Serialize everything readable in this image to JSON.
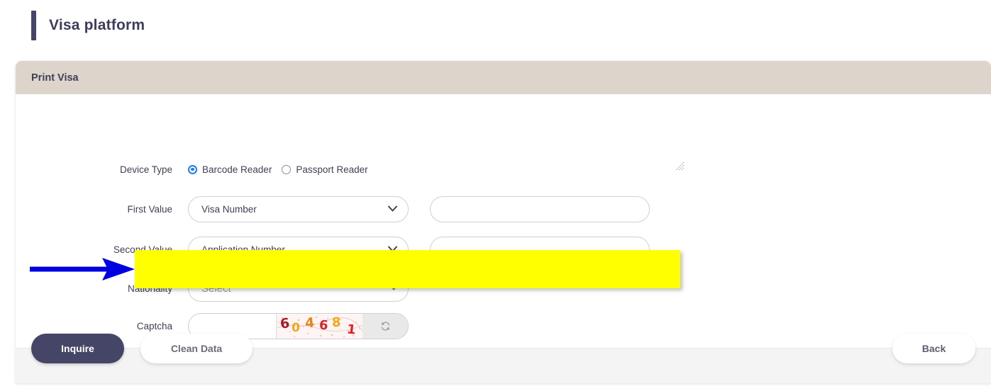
{
  "page": {
    "title": "Visa platform",
    "accent_color": "#454567"
  },
  "card": {
    "header_title": "Print Visa",
    "header_bg": "#ddd5cb"
  },
  "form": {
    "device_type": {
      "label": "Device Type",
      "options": [
        {
          "label": "Barcode Reader",
          "selected": true
        },
        {
          "label": "Passport Reader",
          "selected": false
        }
      ]
    },
    "first_value": {
      "label": "First Value",
      "select_value": "Visa Number",
      "text_value": "",
      "highlighted": true,
      "highlight_color": "#ffff00"
    },
    "second_value": {
      "label": "Second Value",
      "select_value": "Application Number",
      "text_value": ""
    },
    "nationality": {
      "label": "Nationality",
      "placeholder": "Select"
    },
    "captcha": {
      "label": "Captcha",
      "input_value": "",
      "code": "604681",
      "digits": [
        {
          "char": "6",
          "color": "#a81a2a"
        },
        {
          "char": "0",
          "color": "#f2a71b"
        },
        {
          "char": "4",
          "color": "#e8851c"
        },
        {
          "char": "6",
          "color": "#d4262c"
        },
        {
          "char": "8",
          "color": "#f2a71b"
        },
        {
          "char": "1",
          "color": "#e02020"
        }
      ],
      "refresh_icon": "refresh-icon"
    }
  },
  "annotation": {
    "arrow_color": "#0000e0",
    "arrow_target": "First Value"
  },
  "footer": {
    "inquire_label": "Inquire",
    "clean_data_label": "Clean Data",
    "back_label": "Back",
    "primary_color": "#454567"
  }
}
